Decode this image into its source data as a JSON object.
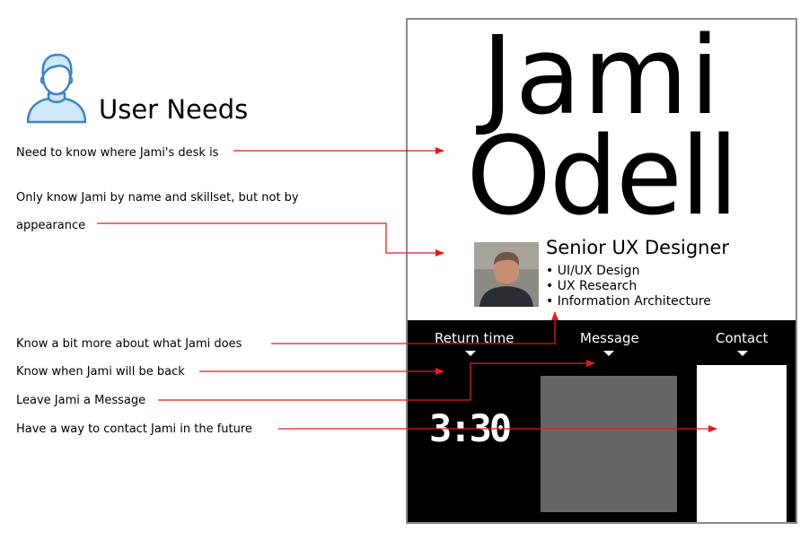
{
  "user_needs": {
    "title": "User Needs",
    "items": [
      "Need to know where Jami's desk is",
      "Only know Jami by name and skillset, but not by appearance",
      "Know a bit more about what Jami does",
      "Know when Jami will be back",
      "Leave Jami a Message",
      "Have a way to contact Jami in the future"
    ]
  },
  "nameplate": {
    "first_name": "Jami",
    "last_name": "Odell",
    "job_title": "Senior UX Designer",
    "skills": [
      "UI/UX Design",
      "UX Research",
      "Information Architecture"
    ],
    "tabs": [
      "Return time",
      "Message",
      "Contact"
    ],
    "return_time": "3:30"
  },
  "colors": {
    "arrow": "#e8191c",
    "icon_stroke": "#3f82c4",
    "icon_fill": "#cde6f8",
    "message_box": "#666666",
    "panel": "#000000"
  },
  "icons": [
    "user-icon"
  ]
}
